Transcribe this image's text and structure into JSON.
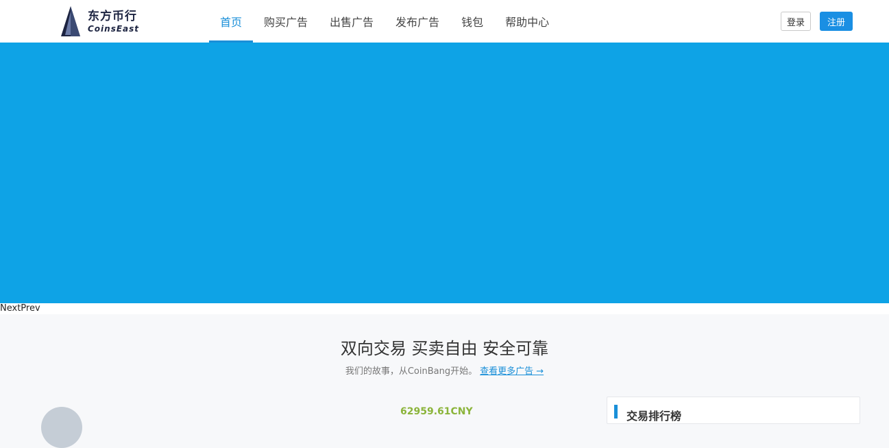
{
  "brand": {
    "name_cn": "东方币行",
    "name_en": "CoinsEast"
  },
  "nav": {
    "items": [
      {
        "label": "首页",
        "active": true
      },
      {
        "label": "购买广告",
        "active": false
      },
      {
        "label": "出售广告",
        "active": false
      },
      {
        "label": "发布广告",
        "active": false
      },
      {
        "label": "钱包",
        "active": false
      },
      {
        "label": "帮助中心",
        "active": false
      }
    ]
  },
  "auth": {
    "login_label": "登录",
    "register_label": "注册"
  },
  "banner": {
    "color": "#0ea3e6"
  },
  "slider": {
    "next_label": "Next",
    "prev_label": "Prev"
  },
  "intro": {
    "title": "双向交易 买卖自由 安全可靠",
    "subtitle": "我们的故事，从CoinBang开始。",
    "more_link": "查看更多广告 →"
  },
  "ticker": {
    "price": "62959.61CNY"
  },
  "ranking": {
    "title": "交易排行榜"
  },
  "colors": {
    "accent": "#1a8fd8",
    "price": "#8bb43a"
  }
}
